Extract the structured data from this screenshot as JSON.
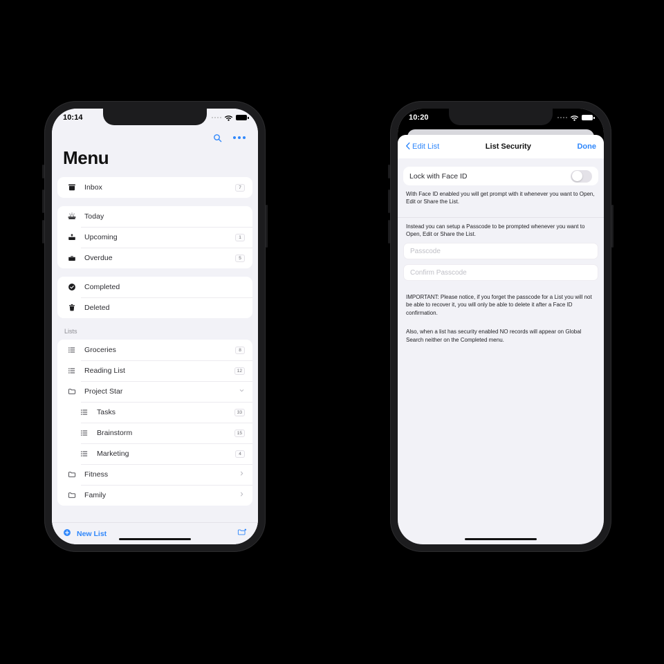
{
  "phone1": {
    "status": {
      "time": "10:14",
      "signal_icon": "signal-dots-icon",
      "wifi_icon": "wifi-icon",
      "battery_icon": "battery-full-icon"
    },
    "header": {
      "title": "Menu",
      "search_icon": "search-icon",
      "more_icon": "more-horizontal-icon"
    },
    "groups": [
      {
        "label": "",
        "rows": [
          {
            "icon": "inbox-icon",
            "label": "Inbox",
            "badge": "7",
            "indent": false,
            "accessory": "badge"
          }
        ]
      },
      {
        "label": "",
        "rows": [
          {
            "icon": "sunrise-icon",
            "label": "Today",
            "badge": "",
            "indent": false,
            "accessory": "none"
          },
          {
            "icon": "tray-upcoming-icon",
            "label": "Upcoming",
            "badge": "1",
            "indent": false,
            "accessory": "badge"
          },
          {
            "icon": "tray-overdue-icon",
            "label": "Overdue",
            "badge": "5",
            "indent": false,
            "accessory": "badge"
          }
        ]
      },
      {
        "label": "",
        "rows": [
          {
            "icon": "check-circle-icon",
            "label": "Completed",
            "badge": "",
            "indent": false,
            "accessory": "none"
          },
          {
            "icon": "trash-icon",
            "label": "Deleted",
            "badge": "",
            "indent": false,
            "accessory": "none"
          }
        ]
      }
    ],
    "lists_section_label": "Lists",
    "lists": [
      {
        "icon": "list-icon",
        "label": "Groceries",
        "badge": "8",
        "indent": false,
        "accessory": "badge"
      },
      {
        "icon": "list-icon",
        "label": "Reading List",
        "badge": "12",
        "indent": false,
        "accessory": "badge"
      },
      {
        "icon": "folder-icon",
        "label": "Project Star",
        "badge": "",
        "indent": false,
        "accessory": "chevron-down"
      },
      {
        "icon": "list-icon",
        "label": "Tasks",
        "badge": "33",
        "indent": true,
        "accessory": "badge"
      },
      {
        "icon": "list-icon",
        "label": "Brainstorm",
        "badge": "15",
        "indent": true,
        "accessory": "badge"
      },
      {
        "icon": "list-icon",
        "label": "Marketing",
        "badge": "4",
        "indent": true,
        "accessory": "badge"
      },
      {
        "icon": "folder-icon",
        "label": "Fitness",
        "badge": "",
        "indent": false,
        "accessory": "chevron-right"
      },
      {
        "icon": "folder-icon",
        "label": "Family",
        "badge": "",
        "indent": false,
        "accessory": "chevron-right"
      }
    ],
    "bottom_bar": {
      "new_list_label": "New List",
      "plus_icon": "plus-circle-icon",
      "new_folder_icon": "folder-plus-icon"
    }
  },
  "phone2": {
    "status": {
      "time": "10:20",
      "signal_icon": "signal-dots-icon",
      "wifi_icon": "wifi-icon",
      "battery_icon": "battery-full-icon"
    },
    "navbar": {
      "back_icon": "chevron-left-icon",
      "back_label": "Edit List",
      "title": "List Security",
      "done_label": "Done"
    },
    "faceid_row": {
      "label": "Lock with Face ID",
      "toggle_state": "off"
    },
    "faceid_help": "With Face ID enabled you will get prompt with it whenever you want to Open, Edit or Share the List.",
    "passcode_help": "Instead you can setup a Passcode to be prompted whenever you want to Open, Edit or Share the List.",
    "fields": [
      {
        "placeholder": "Passcode",
        "value": ""
      },
      {
        "placeholder": "Confirm Passcode",
        "value": ""
      }
    ],
    "notes": [
      "IMPORTANT: Please notice, if you forget the passcode for a List you will not be able to recover it, you will only be able to delete it after a Face ID confirmation.",
      "Also, when a list has security enabled NO records will appear on Global Search neither on the Completed menu."
    ]
  },
  "colors": {
    "accent": "#2f87fb",
    "screen_bg": "#f2f2f7",
    "card_bg": "#ffffff",
    "frame": "#1c1c1e",
    "page_bg": "#000000"
  }
}
